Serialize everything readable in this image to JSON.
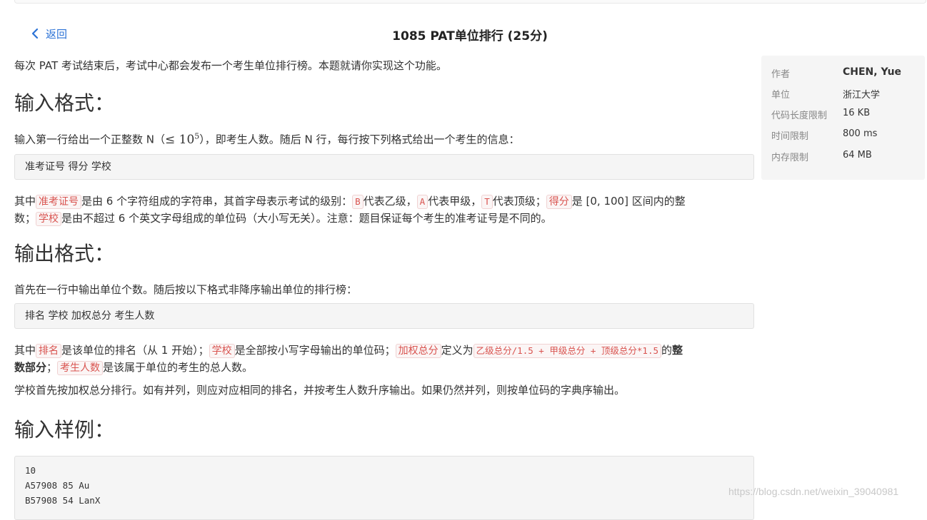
{
  "nav": {
    "back_label": "返回"
  },
  "page_title": "1085 PAT单位排行 (25分)",
  "intro": "每次 PAT 考试结束后，考试中心都会发布一个考生单位排行榜。本题就请你实现这个功能。",
  "input_section": {
    "heading": "输入格式：",
    "line1_before": "输入第一行给出一个正整数 N（",
    "line1_math_base": "≤ 10",
    "line1_math_exp": "5",
    "line1_after": "），即考生人数。随后 N 行，每行按下列格式给出一个考生的信息：",
    "format_code": "准考证号 得分 学校",
    "desc_1": "其中",
    "tag_id": "准考证号",
    "desc_2": "是由 6 个字符组成的字符串，其首字母表示考试的级别：",
    "tag_b": "B",
    "desc_3": "代表乙级，",
    "tag_a": "A",
    "desc_4": "代表甲级，",
    "tag_t": "T",
    "desc_5": "代表顶级；",
    "tag_score": "得分",
    "desc_6": "是 [0, 100] 区间内的整",
    "desc_7": "数；",
    "tag_school": "学校",
    "desc_8": "是由不超过 6 个英文字母组成的单位码（大小写无关）。注意：题目保证每个考生的准考证号是不同的。"
  },
  "output_section": {
    "heading": "输出格式：",
    "line1": "首先在一行中输出单位个数。随后按以下格式非降序输出单位的排行榜：",
    "format_code": "排名 学校 加权总分 考生人数",
    "d1": "其中",
    "tag_rank": "排名",
    "d2": "是该单位的排名（从 1 开始）；",
    "tag_school": "学校",
    "d3": "是全部按小写字母输出的单位码；",
    "tag_weighted": "加权总分",
    "d4": "定义为",
    "formula": "乙级总分/1.5 + 甲级总分 + 顶级总分*1.5",
    "d5": "的",
    "d6_bold": "整",
    "d7_bold": "数部分",
    "d8": "；",
    "tag_count": "考生人数",
    "d9": "是该属于单位的考生的总人数。",
    "line3": "学校首先按加权总分排行。如有并列，则应对应相同的排名，并按考生人数升序输出。如果仍然并列，则按单位码的字典序输出。"
  },
  "sample_section": {
    "heading": "输入样例：",
    "lines": [
      "10",
      "A57908 85 Au",
      "B57908 54 LanX"
    ]
  },
  "info_panel": {
    "rows": [
      {
        "label": "作者",
        "value": "CHEN, Yue"
      },
      {
        "label": "单位",
        "value": "浙江大学"
      },
      {
        "label": "代码长度限制",
        "value": "16 KB"
      },
      {
        "label": "时间限制",
        "value": "800 ms"
      },
      {
        "label": "内存限制",
        "value": "64 MB"
      }
    ]
  },
  "watermark": "https://blog.csdn.net/weixin_39040981",
  "colors": {
    "link": "#2b72d6",
    "tag_text": "#d9534f",
    "code_bg": "#f5f5f5"
  }
}
